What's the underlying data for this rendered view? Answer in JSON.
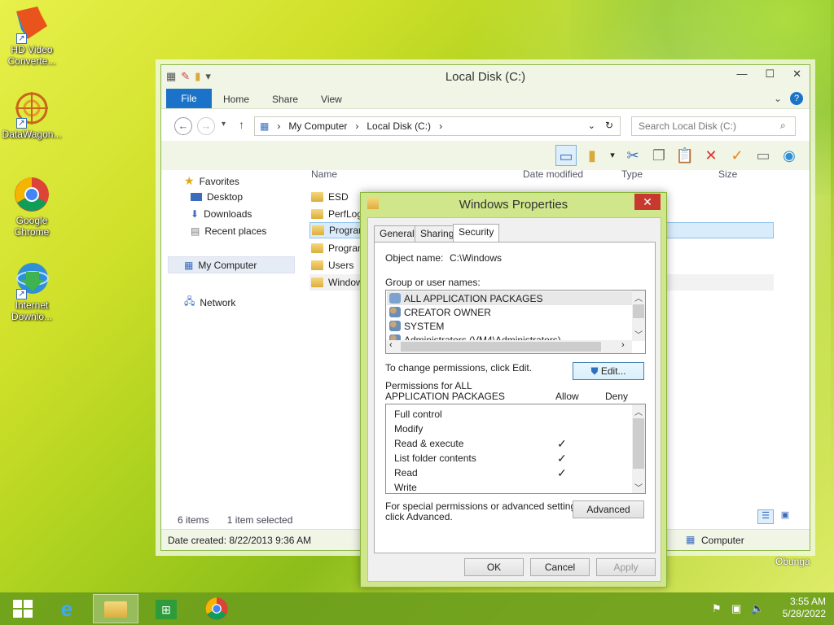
{
  "desktop": {
    "icons": [
      {
        "label": "HD Video Converte...",
        "icon": "hd-video-converter-icon"
      },
      {
        "label": "DataWagon...",
        "icon": "datawagon-icon"
      },
      {
        "label": "Google Chrome",
        "icon": "chrome-icon"
      },
      {
        "label": "Internet Downlo...",
        "icon": "internet-download-manager-icon"
      }
    ],
    "watermark": "Obunga"
  },
  "explorer": {
    "title": "Local Disk (C:)",
    "ribbon_tabs": [
      "File",
      "Home",
      "Share",
      "View"
    ],
    "address_parts": [
      "My Computer",
      "Local Disk (C:)"
    ],
    "search_placeholder": "Search Local Disk (C:)",
    "nav": {
      "favorites": "Favorites",
      "desktop": "Desktop",
      "downloads": "Downloads",
      "recent": "Recent places",
      "my_computer": "My Computer",
      "network": "Network"
    },
    "columns": {
      "name": "Name",
      "date": "Date modified",
      "type": "Type",
      "size": "Size"
    },
    "files": [
      "ESD",
      "PerfLog",
      "Program",
      "Program",
      "Users",
      "Window"
    ],
    "status": {
      "count": "6 items",
      "selected": "1 item selected"
    },
    "details": {
      "date_created": "Date created: 8/22/2013 9:36 AM",
      "location": "Computer"
    }
  },
  "dialog": {
    "title": "Windows Properties",
    "close_glyph": "✕",
    "tabs": [
      "General",
      "Sharing",
      "Security"
    ],
    "object_label": "Object name:",
    "object_value": "C:\\Windows",
    "group_label": "Group or user names:",
    "groups": [
      "ALL APPLICATION PACKAGES",
      "CREATOR OWNER",
      "SYSTEM",
      "Administrators (VM4\\Administrators)"
    ],
    "change_text": "To change permissions, click Edit.",
    "edit_label": "Edit...",
    "perm_title_1": "Permissions for ALL",
    "perm_title_2": "APPLICATION PACKAGES",
    "allow": "Allow",
    "deny": "Deny",
    "permissions": [
      {
        "name": "Full control",
        "allow": ""
      },
      {
        "name": "Modify",
        "allow": ""
      },
      {
        "name": "Read & execute",
        "allow": "✓"
      },
      {
        "name": "List folder contents",
        "allow": "✓"
      },
      {
        "name": "Read",
        "allow": "✓"
      },
      {
        "name": "Write",
        "allow": ""
      }
    ],
    "special_text_1": "For special permissions or advanced settings,",
    "special_text_2": "click Advanced.",
    "advanced_label": "Advanced",
    "ok_label": "OK",
    "cancel_label": "Cancel",
    "apply_label": "Apply"
  },
  "taskbar": {
    "time": "3:55 AM",
    "date": "5/28/2022"
  }
}
